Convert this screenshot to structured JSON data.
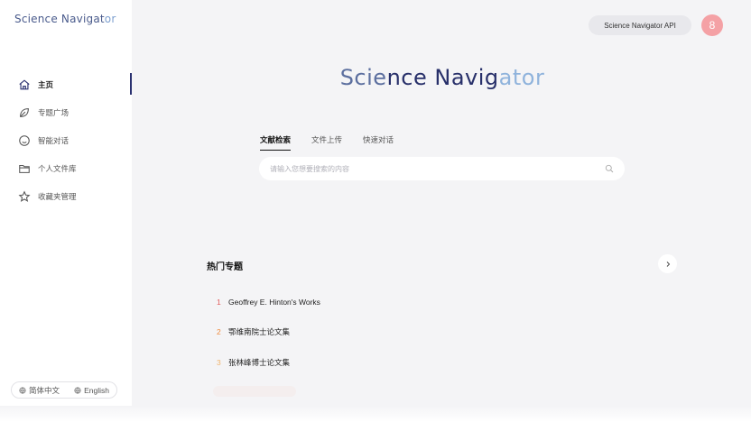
{
  "sidebar": {
    "logo": {
      "part1": "Scie",
      "part2": "nce Navig",
      "part3": "at",
      "part4": "or"
    },
    "items": [
      {
        "label": "主页",
        "icon": "home-icon",
        "active": true
      },
      {
        "label": "专题广场",
        "icon": "leaf-icon",
        "active": false
      },
      {
        "label": "智能对话",
        "icon": "smile-chat-icon",
        "active": false
      },
      {
        "label": "个人文件库",
        "icon": "folder-icon",
        "active": false
      },
      {
        "label": "收藏夹管理",
        "icon": "star-icon",
        "active": false
      }
    ],
    "languages": [
      {
        "label": "简体中文",
        "icon": "globe-icon"
      },
      {
        "label": "English",
        "icon": "globe-icon"
      }
    ]
  },
  "header": {
    "api_button": "Science Navigator API",
    "avatar_text": "8"
  },
  "hero": {
    "title_a": "Scie",
    "title_b": "nce Navig",
    "title_c": "ator"
  },
  "tabs": [
    {
      "label": "文献检索",
      "active": true
    },
    {
      "label": "文件上传",
      "active": false
    },
    {
      "label": "快速对话",
      "active": false
    }
  ],
  "search": {
    "placeholder": "请输入您想要搜索的内容",
    "value": ""
  },
  "hot_topics": {
    "title": "热门专题",
    "items": [
      {
        "rank": "1",
        "title": "Geoffrey E. Hinton's Works"
      },
      {
        "rank": "2",
        "title": "鄂维南院士论文集"
      },
      {
        "rank": "3",
        "title": "张林峰博士论文集"
      }
    ]
  },
  "colors": {
    "accent_dark": "#28306a",
    "avatar_bg": "#f4a1a5",
    "rank1": "#e25b5b",
    "rank2": "#ef8a3c",
    "rank3": "#f0b46d"
  }
}
